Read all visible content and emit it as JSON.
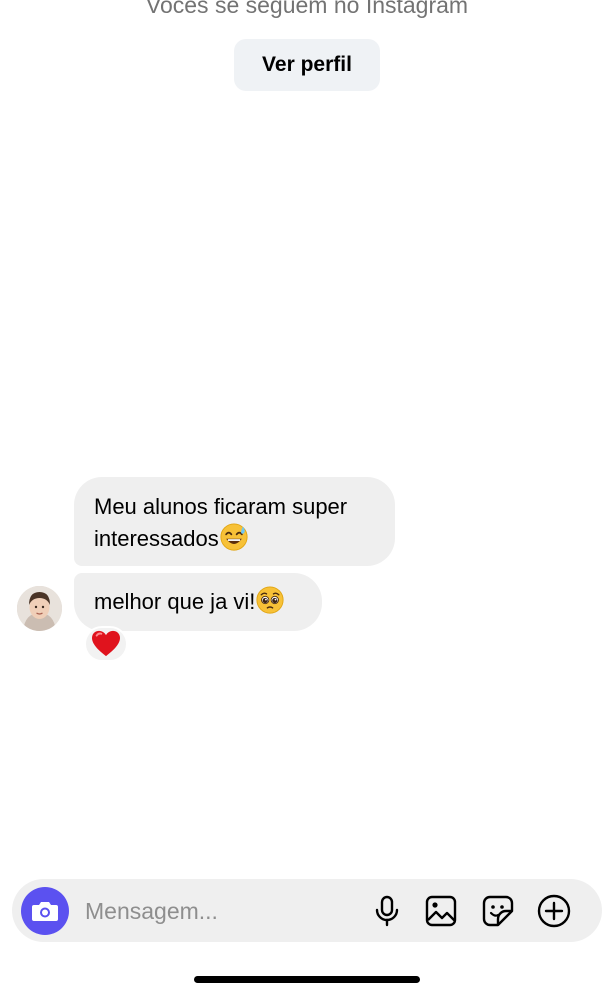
{
  "header": {
    "follow_note": "Vocês se seguem no Instagram",
    "profile_button": "Ver perfil"
  },
  "messages": [
    {
      "line1": "Meu alunos ficaram super",
      "line2": "interessados",
      "emoji": "grinning-sweat-emoji"
    },
    {
      "text": "melhor que ja vi!",
      "emoji": "pleading-face-emoji",
      "reaction": "red-heart"
    }
  ],
  "composer": {
    "placeholder": "Mensagem...",
    "value": "",
    "accent": "#5b51f0",
    "icons": [
      "camera-icon",
      "microphone-icon",
      "gallery-icon",
      "sticker-icon",
      "plus-icon"
    ]
  }
}
